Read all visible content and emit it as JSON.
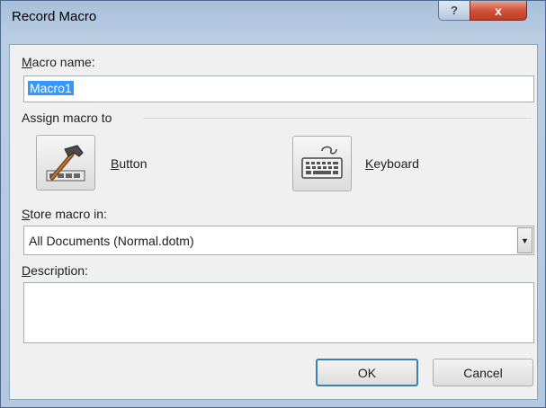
{
  "window": {
    "title": "Record Macro",
    "help_glyph": "?",
    "close_glyph": "x"
  },
  "macro_name": {
    "label_u": "M",
    "label_rest": "acro name:",
    "value": "Macro1"
  },
  "assign": {
    "heading": "Assign macro to",
    "button_label_u": "B",
    "button_label_rest": "utton",
    "keyboard_label_u": "K",
    "keyboard_label_rest": "eyboard",
    "button_icon": "hammer-toolbar-icon",
    "keyboard_icon": "keyboard-icon"
  },
  "store": {
    "label_u": "S",
    "label_rest": "tore macro in:",
    "selected": "All Documents (Normal.dotm)",
    "arrow_glyph": "▼"
  },
  "description": {
    "label_u": "D",
    "label_rest": "escription:",
    "value": ""
  },
  "actions": {
    "ok": "OK",
    "cancel": "Cancel"
  },
  "colors": {
    "selection": "#3399ff",
    "close_button": "#c43b25",
    "default_button_border": "#3c7fb1"
  }
}
